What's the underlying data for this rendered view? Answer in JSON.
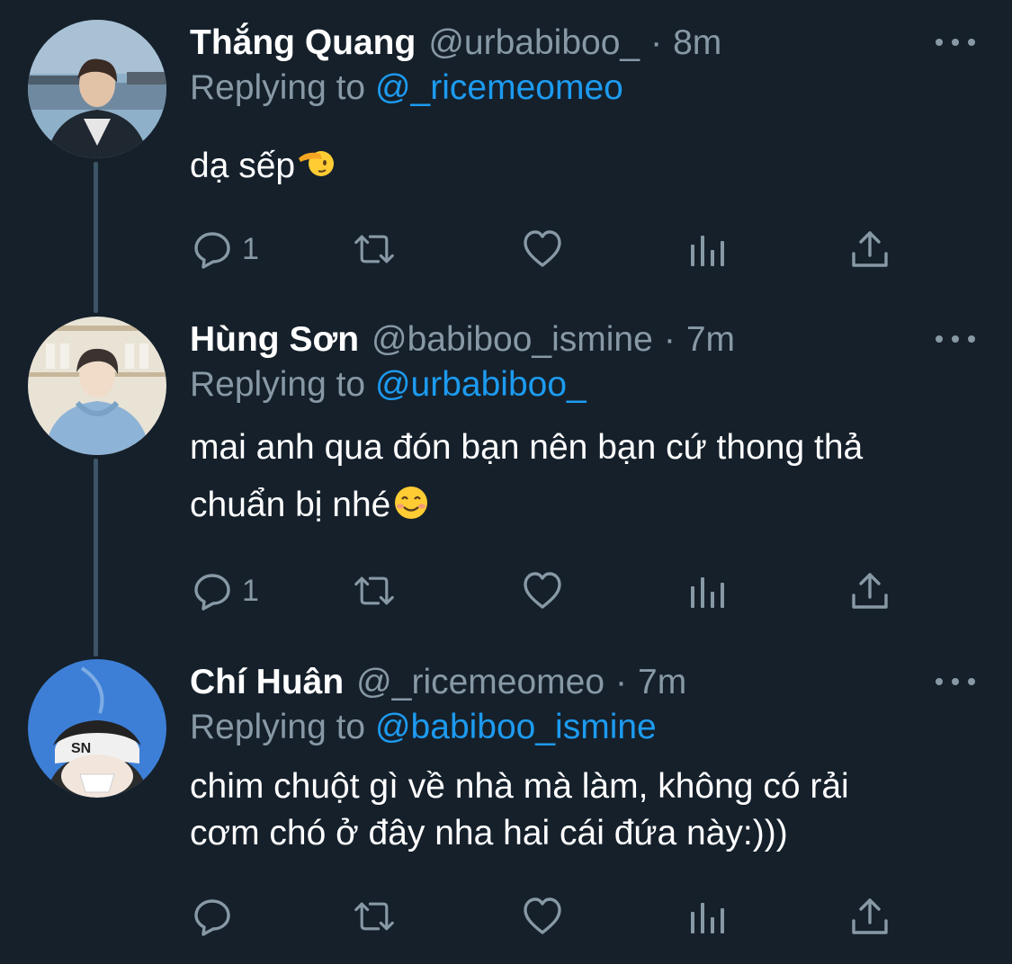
{
  "colors": {
    "background": "#15202b",
    "text_primary": "#ffffff",
    "text_secondary": "#8899a6",
    "accent_link": "#1d9bf0",
    "thread_line": "#3d5466"
  },
  "icons": {
    "reply": "reply-bubble-icon",
    "retweet": "retweet-icon",
    "like": "heart-icon",
    "analytics": "analytics-bars-icon",
    "share": "share-upload-icon",
    "more": "more-dots-icon"
  },
  "tweets": [
    {
      "name": "Thắng Quang",
      "handle": "@urbabiboo_",
      "separator": "·",
      "time": "8m",
      "replying_prefix": "Replying to",
      "replying_to": "@_ricemeomeo",
      "text_lines": [
        "dạ sếp"
      ],
      "emoji": "saluting-face-emoji",
      "reply_count": "1"
    },
    {
      "name": "Hùng Sơn",
      "handle": "@babiboo_ismine",
      "separator": "·",
      "time": "7m",
      "replying_prefix": "Replying to",
      "replying_to": "@urbabiboo_",
      "text_lines": [
        "mai anh qua đón bạn nên bạn cứ thong thả",
        "chuẩn bị nhé"
      ],
      "emoji": "smiling-face-emoji",
      "reply_count": "1"
    },
    {
      "name": "Chí Huân",
      "handle": "@_ricemeomeo",
      "separator": "·",
      "time": "7m",
      "replying_prefix": "Replying to",
      "replying_to": "@babiboo_ismine",
      "text_lines": [
        "chim chuột gì về nhà mà làm, không có rải",
        "cơm chó ở đây nha hai cái đứa này:)))"
      ],
      "emoji": "",
      "reply_count": ""
    }
  ]
}
